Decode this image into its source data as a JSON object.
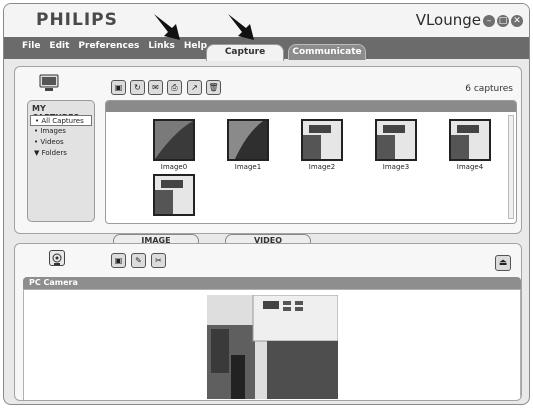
{
  "brand": "PHILIPS",
  "app_title": "VLounge",
  "window_buttons": [
    "–",
    "□",
    "✕"
  ],
  "menu": [
    "File",
    "Edit",
    "Preferences",
    "Links",
    "Help"
  ],
  "tabs": {
    "capture": "Capture",
    "communicate": "Communicate"
  },
  "captures_count": "6 captures",
  "sidebar": {
    "title": "MY CAPTURES",
    "items": [
      {
        "label": "All Captures",
        "bullet": "•"
      },
      {
        "label": "Images",
        "bullet": "•"
      },
      {
        "label": "Videos",
        "bullet": "•"
      },
      {
        "label": "Folders",
        "bullet": "▼"
      }
    ]
  },
  "thumbnails": [
    "Image0",
    "Image1",
    "Image2",
    "Image3",
    "Image4",
    ""
  ],
  "splitter": {
    "image": "IMAGE",
    "video": "VIDEO"
  },
  "camera": {
    "label": "PC Camera"
  },
  "colors": {
    "menubar": "#6b6b6b",
    "accent": "#8a8a8a"
  }
}
